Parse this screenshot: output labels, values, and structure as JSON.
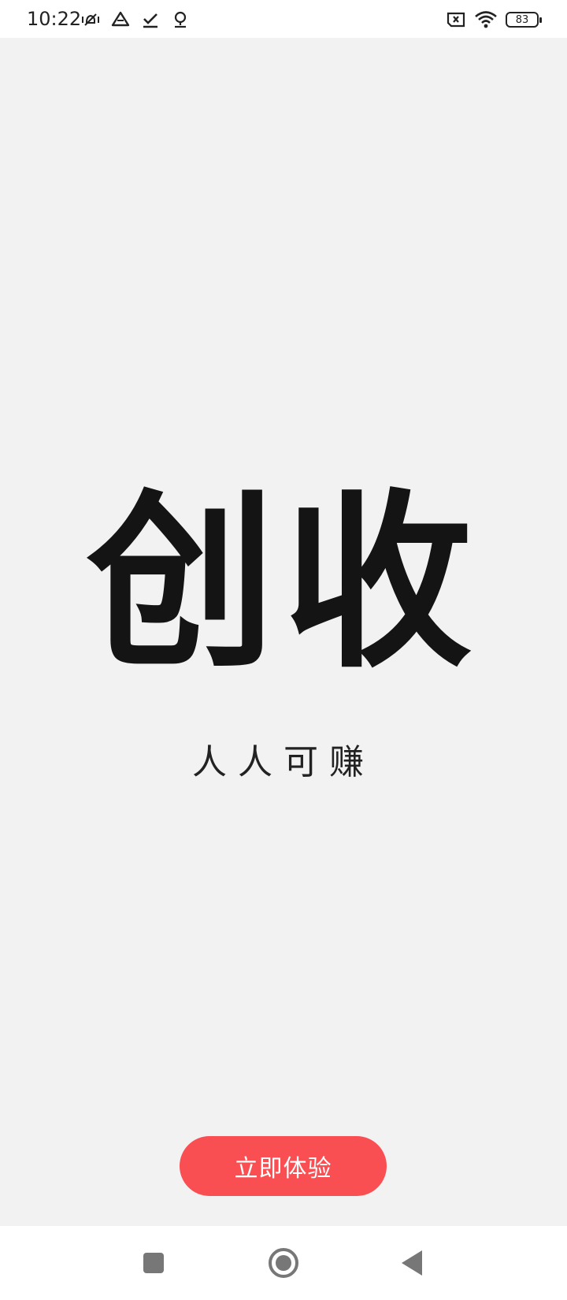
{
  "status_bar": {
    "time": "10:22",
    "battery": "83",
    "left_icons": [
      "mute-vibrate-icon",
      "drive-icon",
      "download-done-icon",
      "location-icon"
    ],
    "right_icons": [
      "no-sim-icon",
      "wifi-icon",
      "battery-icon"
    ]
  },
  "hero": {
    "title": "创收",
    "subtitle": "人人可赚"
  },
  "cta": {
    "label": "立即体验",
    "color": "#fa4f52"
  },
  "nav_bar": {
    "buttons": [
      "recent-apps-icon",
      "home-icon",
      "back-icon"
    ]
  }
}
